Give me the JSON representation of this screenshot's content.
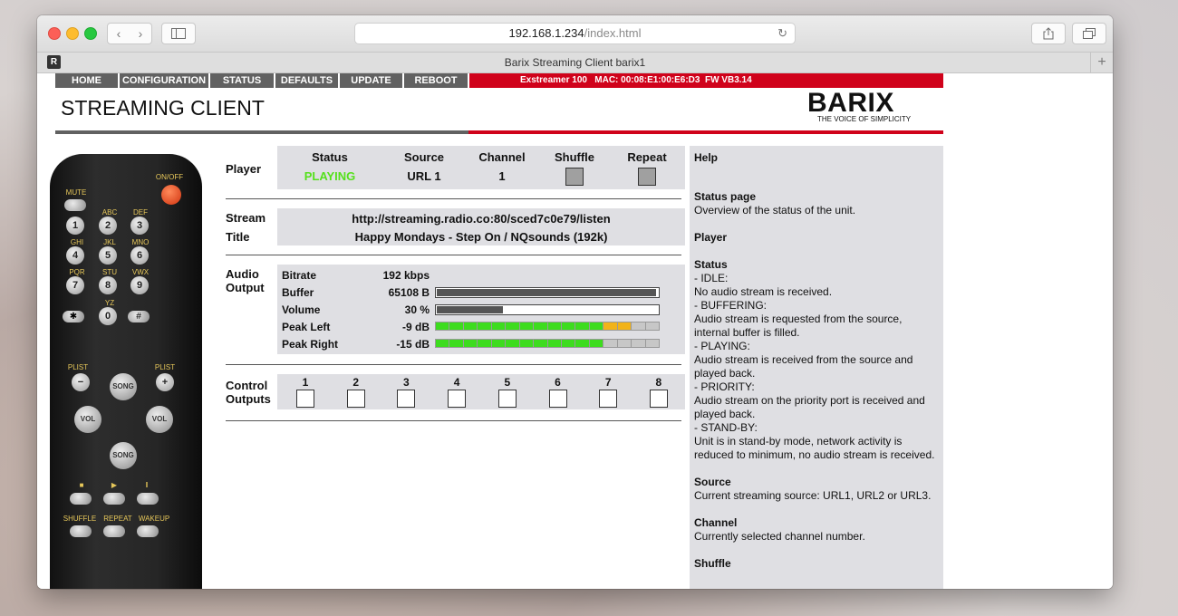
{
  "browser": {
    "url_host": "192.168.1.234",
    "url_path": "/index.html",
    "tab_title": "Barix Streaming Client barix1",
    "favicon_letter": "R"
  },
  "menu": {
    "items": [
      "HOME",
      "CONFIGURATION",
      "STATUS",
      "DEFAULTS",
      "UPDATE",
      "REBOOT"
    ],
    "device_info": "Exstreamer 100   MAC: 00:08:E1:00:E6:D3  FW VB3.14"
  },
  "page": {
    "title": "STREAMING CLIENT",
    "logo": "BARIX",
    "logo_tagline": "THE VOICE OF SIMPLICITY"
  },
  "remote": {
    "mute": "MUTE",
    "onoff": "ON/OFF",
    "keys": [
      "1",
      "2",
      "3",
      "4",
      "5",
      "6",
      "7",
      "8",
      "9",
      "✱",
      "0",
      "#"
    ],
    "letters": [
      "ABC",
      "DEF",
      "GHI",
      "JKL",
      "MNO",
      "PQR",
      "STU",
      "VWX",
      "YZ"
    ],
    "plist": "PLIST",
    "song": "SONG",
    "vol": "VOL",
    "shuffle": "SHUFFLE",
    "repeat": "REPEAT",
    "wakeup": "WAKEUP"
  },
  "player": {
    "label": "Player",
    "headers": [
      "Status",
      "Source",
      "Channel",
      "Shuffle",
      "Repeat"
    ],
    "status": "PLAYING",
    "status_color": "#55e01c",
    "source": "URL 1",
    "channel": "1"
  },
  "stream": {
    "label_stream": "Stream",
    "label_title": "Title",
    "url": "http://streaming.radio.co:80/sced7c0e79/listen",
    "title": "Happy Mondays - Step On / NQsounds (192k)"
  },
  "audio": {
    "label_line1": "Audio",
    "label_line2": "Output",
    "bitrate_label": "Bitrate",
    "bitrate": "192 kbps",
    "buffer_label": "Buffer",
    "buffer": "65108 B",
    "buffer_level": 0.99,
    "volume_label": "Volume",
    "volume": "30 %",
    "volume_level": 0.3,
    "peak_left_label": "Peak Left",
    "peak_left": "-9 dB",
    "peak_left_segments": {
      "green": 12,
      "yellow": 2,
      "total": 16
    },
    "peak_right_label": "Peak Right",
    "peak_right": "-15 dB",
    "peak_right_segments": {
      "green": 12,
      "yellow": 0,
      "total": 16
    }
  },
  "control": {
    "label_line1": "Control",
    "label_line2": "Outputs",
    "outputs": [
      "1",
      "2",
      "3",
      "4",
      "5",
      "6",
      "7",
      "8"
    ]
  },
  "help": {
    "title": "Help",
    "status_page_h": "Status page",
    "status_page_t": "Overview of the status of the unit.",
    "player_h": "Player",
    "status_h": "Status",
    "lines": [
      "- IDLE:",
      "No audio stream is received.",
      "- BUFFERING:",
      "Audio stream is requested from the source, internal buffer is filled.",
      "- PLAYING:",
      "Audio stream is received from the source and played back.",
      "- PRIORITY:",
      "Audio stream on the priority port is received and played back.",
      "- STAND-BY:",
      "Unit is in stand-by mode, network activity is reduced to minimum, no audio stream is received."
    ],
    "source_h": "Source",
    "source_t": "Current streaming source: URL1, URL2 or URL3.",
    "channel_h": "Channel",
    "channel_t": "Currently selected channel number.",
    "shuffle_h": "Shuffle"
  }
}
